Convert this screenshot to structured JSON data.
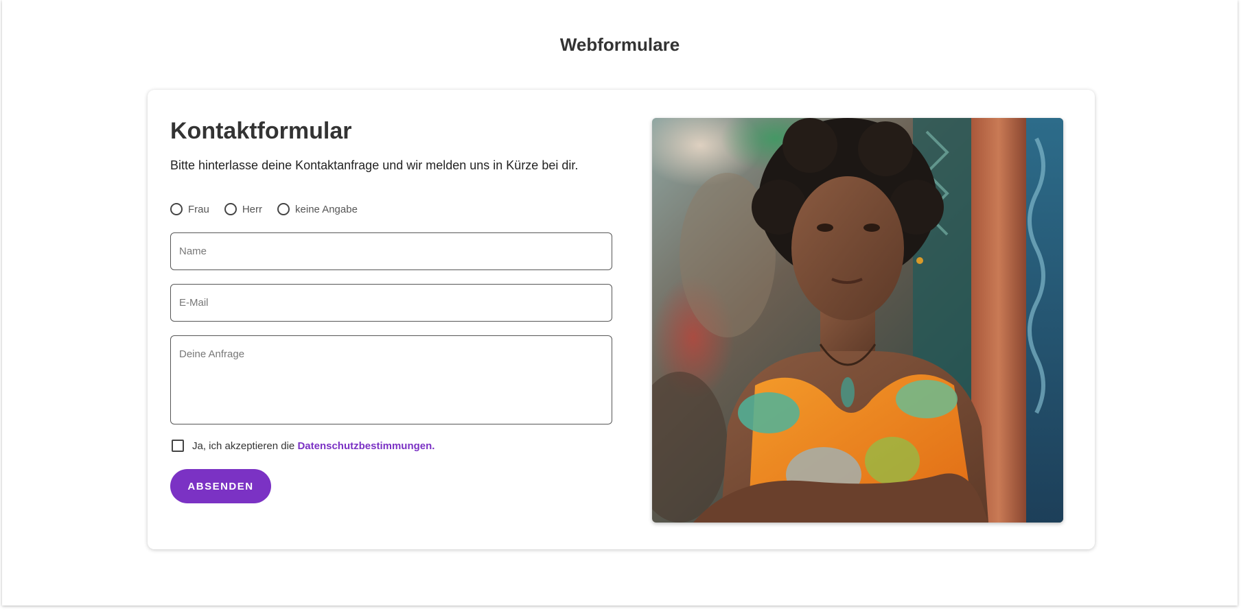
{
  "page": {
    "title": "Webformulare"
  },
  "form": {
    "heading": "Kontaktformular",
    "intro": "Bitte hinterlasse deine Kontaktanfrage und wir melden uns in Kürze bei dir.",
    "salutation_options": [
      "Frau",
      "Herr",
      "keine Angabe"
    ],
    "name_placeholder": "Name",
    "email_placeholder": "E-Mail",
    "message_placeholder": "Deine Anfrage",
    "consent_text": "Ja, ich akzeptieren die",
    "consent_link": "Datenschutzbestimmungen.",
    "submit_label": "ABSENDEN"
  },
  "colors": {
    "accent": "#7b32c4",
    "text": "#333333"
  }
}
